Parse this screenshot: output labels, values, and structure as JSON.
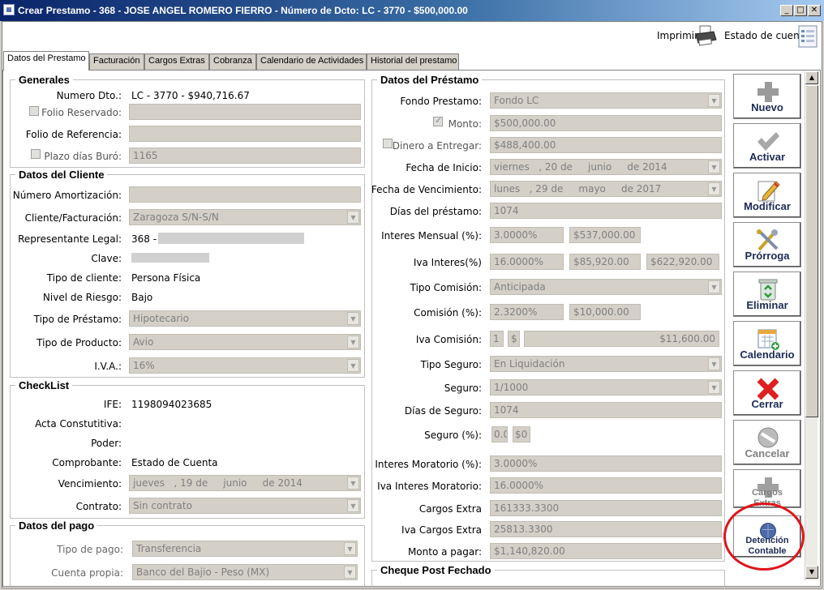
{
  "window": {
    "title": "Crear Prestamo - 368 - JOSE ANGEL ROMERO FIERRO - Número de Dcto: LC - 3770 - $500,000.00",
    "minimize": "_",
    "maximize": "□",
    "close": "✕"
  },
  "toolbar": {
    "print_label": "Imprimir",
    "statement_label": "Estado de cuenta"
  },
  "tabs": [
    {
      "label": "Datos del Prestamo"
    },
    {
      "label": "Facturación"
    },
    {
      "label": "Cargos Extras"
    },
    {
      "label": "Cobranza"
    },
    {
      "label": "Calendario de Actividades"
    },
    {
      "label": "Historial del prestamo"
    }
  ],
  "generales": {
    "legend": "Generales",
    "numero_label": "Numero Dto.:",
    "numero_value": "LC - 3770 - $940,716.67",
    "folio_reservado_label": "Folio Reservado:",
    "folio_referencia_label": "Folio de Referencia:",
    "plazo_label": "Plazo días Buró:",
    "plazo_value": "1165"
  },
  "cliente": {
    "legend": "Datos del Cliente",
    "amortizacion_label": "Número Amortización:",
    "cliente_label": "Cliente/Facturación:",
    "cliente_value": "Zaragoza S/N-S/N",
    "representante_label": "Representante Legal:",
    "representante_value": "368 -",
    "clave_label": "Clave:",
    "tipo_cliente_label": "Tipo de cliente:",
    "tipo_cliente_value": "Persona Física",
    "riesgo_label": "Nivel de Riesgo:",
    "riesgo_value": "Bajo",
    "tipo_prestamo_label": "Tipo de Préstamo:",
    "tipo_prestamo_value": "Hipotecario",
    "tipo_producto_label": "Tipo de Producto:",
    "tipo_producto_value": "Avio",
    "iva_label": "I.V.A.:",
    "iva_value": "16%"
  },
  "checklist": {
    "legend": "CheckList",
    "ife_label": "IFE:",
    "ife_value": "1198094023685",
    "acta_label": "Acta Constutitiva:",
    "poder_label": "Poder:",
    "comprobante_label": "Comprobante:",
    "comprobante_value": "Estado de Cuenta",
    "vencimiento_label": "Vencimiento:",
    "vencimiento_value": "jueves   , 19 de     junio     de 2014",
    "contrato_label": "Contrato:",
    "contrato_value": "Sin contrato"
  },
  "pago": {
    "legend": "Datos del pago",
    "tipo_label": "Tipo de pago:",
    "tipo_value": "Transferencia",
    "cuenta_label": "Cuenta propia:",
    "cuenta_value": "Banco del Bajio - Peso (MX)"
  },
  "prestamo": {
    "legend": "Datos del Préstamo",
    "fondo_label": "Fondo Prestamo:",
    "fondo_value": "Fondo LC",
    "monto_label": "Monto:",
    "monto_value": "$500,000.00",
    "dinero_label": "Dinero a Entregar:",
    "dinero_value": "$488,400.00",
    "fecha_inicio_label": "Fecha de Inicio:",
    "fecha_inicio_value": "viernes   , 20 de     junio     de 2014",
    "fecha_venc_label": "Fecha de Vencimiento:",
    "fecha_venc_value": "lunes   , 29 de     mayo     de 2017",
    "dias_label": "Días del préstamo:",
    "dias_value": "1074",
    "interes_label": "Interes Mensual (%):",
    "interes_pct": "3.0000%",
    "interes_amt": "$537,000.00",
    "iva_interes_label": "Iva Interes(%)",
    "iva_interes_pct": "16.0000%",
    "iva_interes_amt": "$85,920.00",
    "iva_interes_total": "$622,920.00",
    "tipo_comision_label": "Tipo Comisión:",
    "tipo_comision_value": "Anticipada",
    "comision_label": "Comisión (%):",
    "comision_pct": "2.3200%",
    "comision_amt": "$10,000.00",
    "iva_comision_label": "Iva Comisión:",
    "iva_comision_count": "1",
    "iva_comision_cur": "$",
    "iva_comision_amt": "$11,600.00",
    "tipo_seguro_label": "Tipo Seguro:",
    "tipo_seguro_value": "En Liquidación",
    "seguro_label": "Seguro:",
    "seguro_value": "1/1000",
    "dias_seguro_label": "Días de Seguro:",
    "dias_seguro_value": "1074",
    "seguro_pct_label": "Seguro (%):",
    "seguro_pct_value": "0.0",
    "seguro_amt_value": "$0",
    "moratorio_label": "Interes Moratorio (%):",
    "moratorio_value": "3.0000%",
    "iva_moratorio_label": "Iva Interes Moratorio:",
    "iva_moratorio_value": "16.0000%",
    "cargos_label": "Cargos Extra",
    "cargos_value": "161333.3300",
    "iva_cargos_label": "Iva Cargos Extra",
    "iva_cargos_value": "25813.3300",
    "monto_pagar_label": "Monto a pagar:",
    "monto_pagar_value": "$1,140,820.00"
  },
  "cheque": {
    "legend": "Cheque Post Fechado"
  },
  "actions": {
    "nuevo": "Nuevo",
    "activar": "Activar",
    "modificar": "Modificar",
    "prorroga": "Prórroga",
    "eliminar": "Eliminar",
    "calendario": "Calendario",
    "cerrar": "Cerrar",
    "cancelar": "Cancelar",
    "cargos_extras": "Cargos Extras",
    "detencion_contable": "Detención Contable"
  },
  "colors": {
    "title_gradient_start": "#0a246a",
    "highlight_circle": "#e0151b",
    "button_text": "#1c2a55"
  }
}
